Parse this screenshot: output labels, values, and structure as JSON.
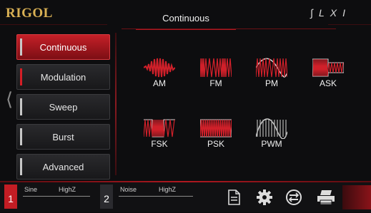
{
  "header": {
    "brand": "RIGOL",
    "title": "Continuous",
    "icons": [
      "signal-icon",
      "lxi-icon"
    ],
    "lxi": "LXI"
  },
  "menu": {
    "items": [
      {
        "label": "Continuous",
        "active": true
      },
      {
        "label": "Modulation",
        "active": false
      },
      {
        "label": "Sweep",
        "active": false
      },
      {
        "label": "Burst",
        "active": false
      },
      {
        "label": "Advanced",
        "active": false
      }
    ]
  },
  "waveforms": [
    {
      "label": "AM",
      "icon": "am-wave-icon"
    },
    {
      "label": "FM",
      "icon": "fm-wave-icon"
    },
    {
      "label": "PM",
      "icon": "pm-wave-icon"
    },
    {
      "label": "ASK",
      "icon": "ask-wave-icon"
    },
    {
      "label": "FSK",
      "icon": "fsk-wave-icon"
    },
    {
      "label": "PSK",
      "icon": "psk-wave-icon"
    },
    {
      "label": "PWM",
      "icon": "pwm-wave-icon"
    }
  ],
  "channels": [
    {
      "num": "1",
      "wave": "Sine",
      "load": "HighZ"
    },
    {
      "num": "2",
      "wave": "Noise",
      "load": "HighZ"
    }
  ],
  "footer_icons": [
    "file-icon",
    "gear-icon",
    "network-icon",
    "printer-icon"
  ],
  "colors": {
    "accent": "#c31d24",
    "brand": "#d8b054",
    "background": "#0d0d0f"
  }
}
